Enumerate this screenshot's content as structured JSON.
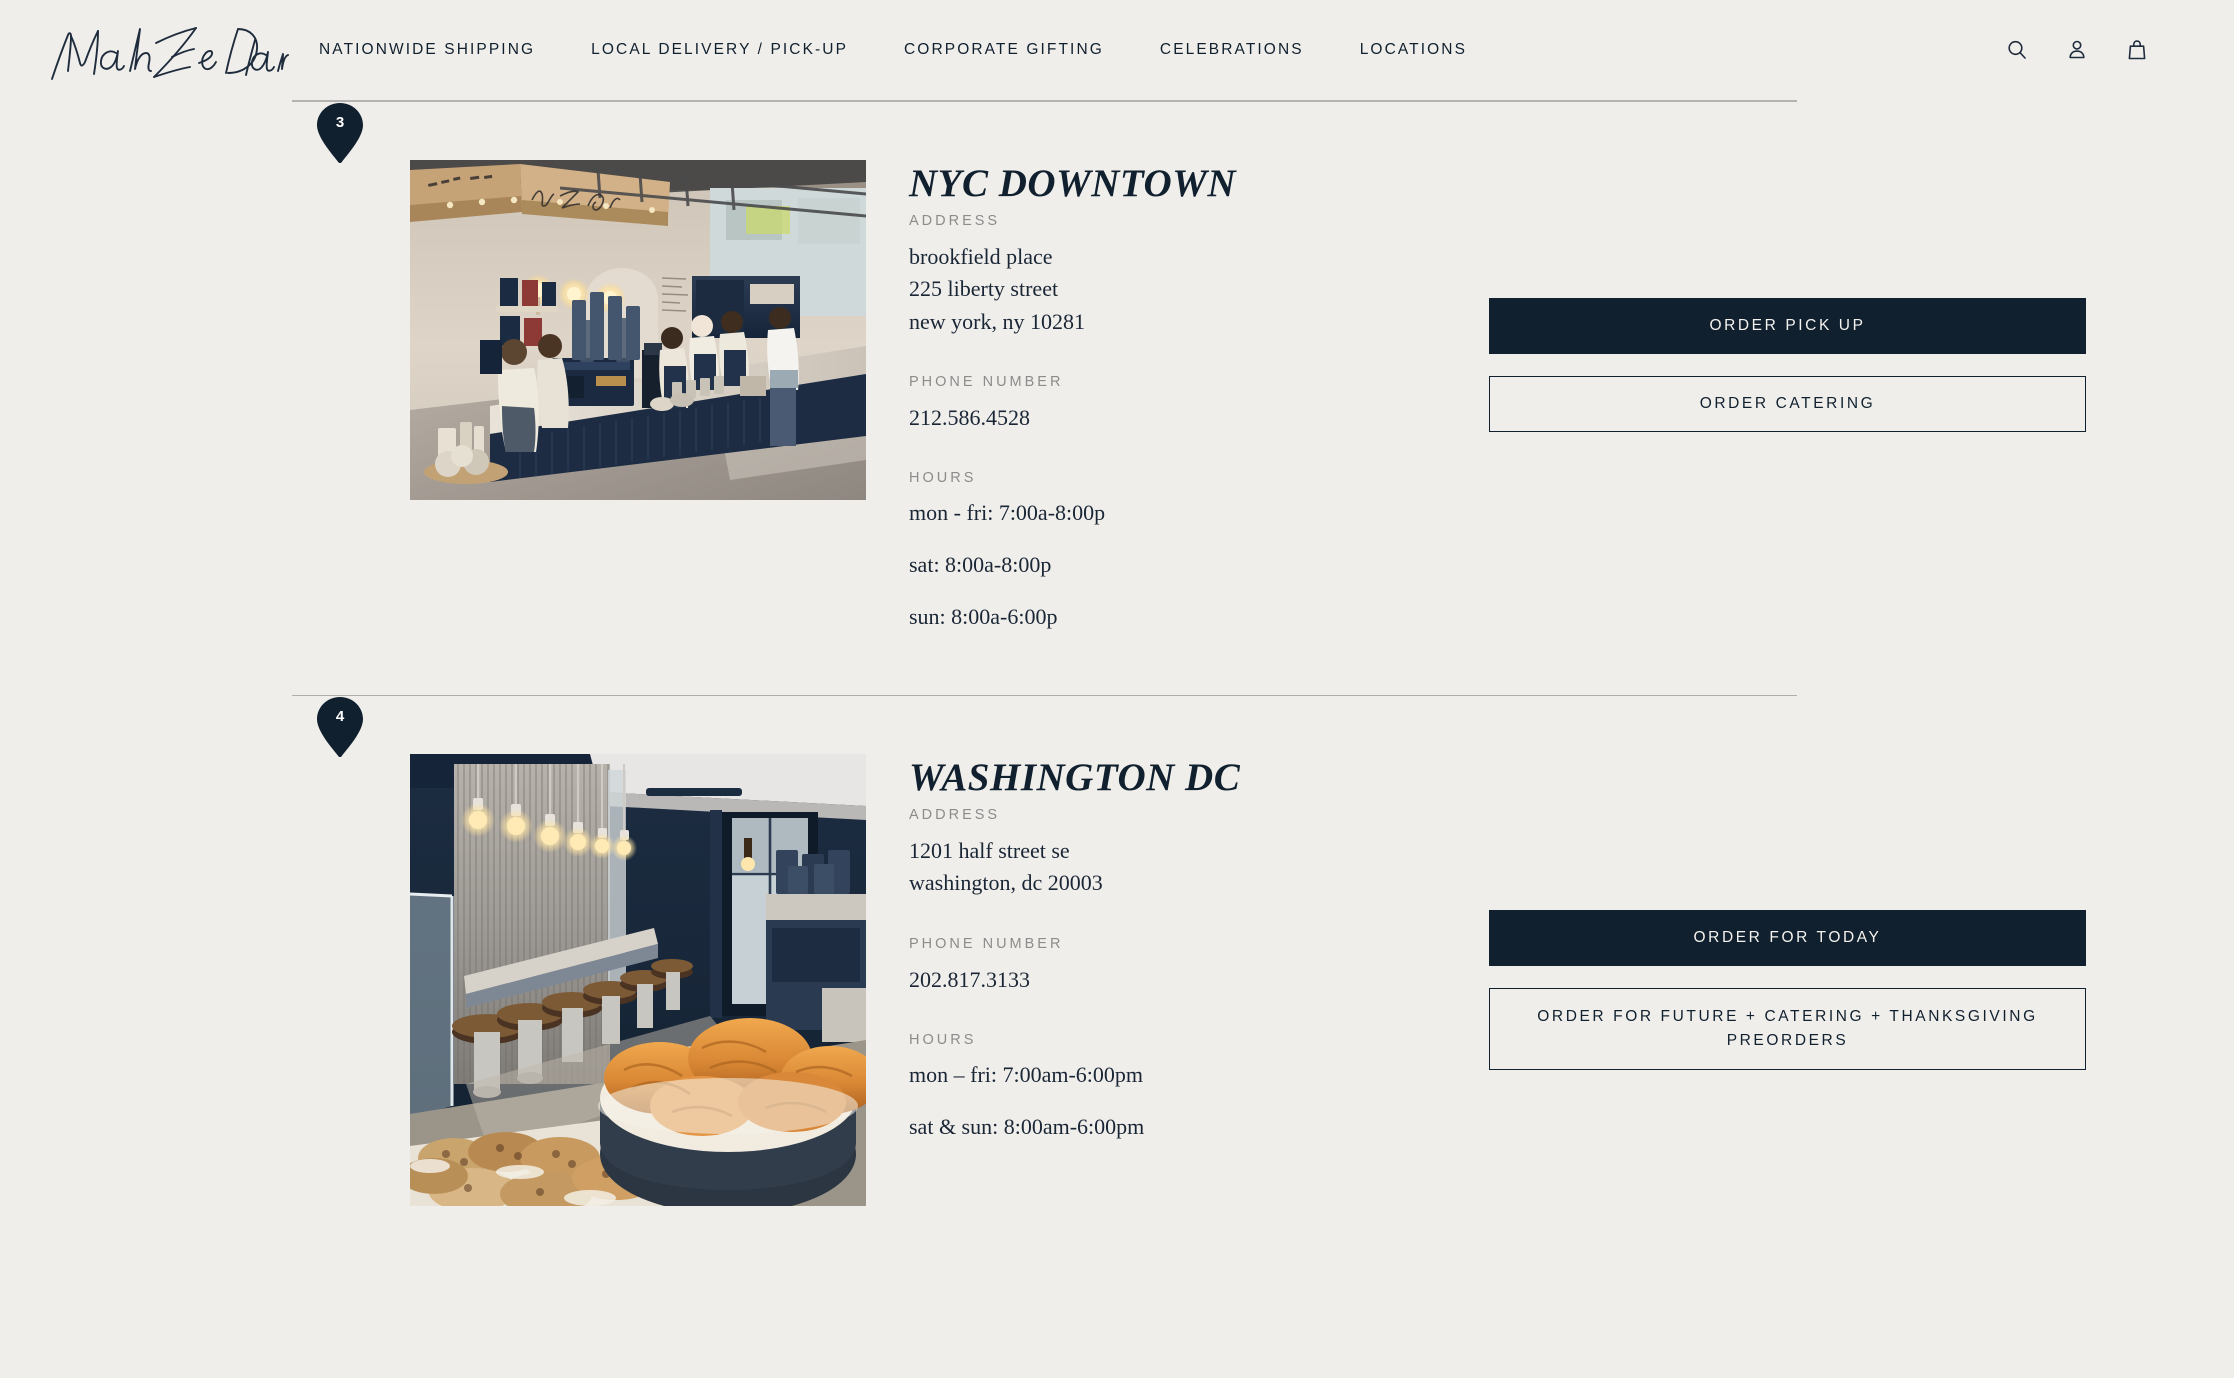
{
  "header": {
    "logo_text": "Mah Ze Dahr",
    "logo_name": "mah-ze-dahr-logo",
    "nav": [
      {
        "label": "NATIONWIDE SHIPPING",
        "name": "nav-nationwide-shipping"
      },
      {
        "label": "LOCAL DELIVERY / PICK-UP",
        "name": "nav-local-delivery-pickup"
      },
      {
        "label": "CORPORATE GIFTING",
        "name": "nav-corporate-gifting"
      },
      {
        "label": "CELEBRATIONS",
        "name": "nav-celebrations"
      },
      {
        "label": "LOCATIONS",
        "name": "nav-locations"
      }
    ],
    "icons": [
      {
        "name": "search-icon",
        "label": "Search"
      },
      {
        "name": "account-icon",
        "label": "Account"
      },
      {
        "name": "shopping-bag-icon",
        "label": "Cart"
      }
    ]
  },
  "labels": {
    "address": "ADDRESS",
    "phone": "PHONE NUMBER",
    "hours": "HOURS"
  },
  "colors": {
    "background": "#efeeea",
    "ink": "#11202f",
    "muted": "#8c8c8c",
    "divider": "#b3b3b3"
  },
  "locations": [
    {
      "pin": "3",
      "title": "NYC DOWNTOWN",
      "address": [
        "brookfield place",
        "225 liberty street",
        "new york, ny 10281"
      ],
      "phone": "212.586.4528",
      "hours": [
        "mon - fri: 7:00a-8:00p",
        "sat: 8:00a-8:00p",
        "sun: 8:00a-6:00p"
      ],
      "primary_button": "ORDER PICK UP",
      "secondary_button": "ORDER CATERING",
      "photo_alt": "mah ze dahr bakery pick up counter with baristas and blue cabinetry"
    },
    {
      "pin": "4",
      "title": "WASHINGTON DC",
      "address": [
        "1201 half street se",
        "washington, dc 20003"
      ],
      "phone": "202.817.3133",
      "hours": [
        "mon – fri: 7:00am-6:00pm",
        "sat & sun: 8:00am-6:00pm"
      ],
      "primary_button": "ORDER FOR TODAY",
      "secondary_button": "ORDER FOR FUTURE + CATERING + THANKSGIVING PREORDERS",
      "photo_alt": "bakery interior with pendant bulbs, bar stools and a bowl of croissants"
    }
  ]
}
